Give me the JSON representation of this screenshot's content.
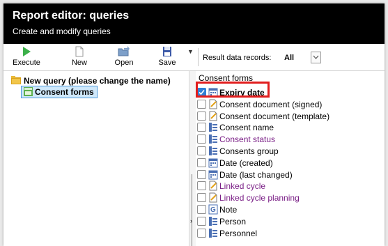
{
  "window": {
    "title": "Report editor: queries",
    "subtitle": "Create and modify queries"
  },
  "toolbar": {
    "buttons": [
      {
        "label": "Execute",
        "icon": "play-icon"
      },
      {
        "label": "New",
        "icon": "new-document-icon"
      },
      {
        "label": "Open",
        "icon": "open-folder-icon"
      },
      {
        "label": "Save",
        "icon": "save-disk-icon"
      }
    ],
    "records_label": "Result data records:",
    "records_value": "All"
  },
  "tree": {
    "root_label": "New query (please change the name)",
    "child_label": "Consent forms"
  },
  "fields": {
    "section_title": "Consent forms",
    "items": [
      {
        "label": "Expiry date",
        "checked": true,
        "bold": true,
        "icon": "date-field-icon",
        "color": "#000000"
      },
      {
        "label": "Consent document (signed)",
        "checked": false,
        "icon": "document-field-icon",
        "color": "#000000"
      },
      {
        "label": "Consent document (template)",
        "checked": false,
        "icon": "document-field-icon",
        "color": "#000000"
      },
      {
        "label": "Consent name",
        "checked": false,
        "icon": "text-field-icon",
        "color": "#000000"
      },
      {
        "label": "Consent status",
        "checked": false,
        "icon": "text-field-icon",
        "color": "#7a1f86"
      },
      {
        "label": "Consents group",
        "checked": false,
        "icon": "text-field-icon",
        "color": "#000000"
      },
      {
        "label": "Date (created)",
        "checked": false,
        "icon": "date-field-icon",
        "color": "#000000"
      },
      {
        "label": "Date (last changed)",
        "checked": false,
        "icon": "date-field-icon",
        "color": "#000000"
      },
      {
        "label": "Linked cycle",
        "checked": false,
        "icon": "link-field-icon",
        "color": "#7a1f86"
      },
      {
        "label": "Linked cycle planning",
        "checked": false,
        "icon": "link-field-icon",
        "color": "#7a1f86"
      },
      {
        "label": "Note",
        "checked": false,
        "icon": "note-field-icon",
        "color": "#000000"
      },
      {
        "label": "Person",
        "checked": false,
        "icon": "text-field-icon",
        "color": "#000000"
      },
      {
        "label": "Personnel",
        "checked": false,
        "icon": "text-field-icon",
        "color": "#000000"
      }
    ]
  },
  "colors": {
    "titlebar": "#000000",
    "selection_bg": "#cfe8fb",
    "highlight_box": "#e11d1d",
    "link_purple": "#7a1f86"
  }
}
